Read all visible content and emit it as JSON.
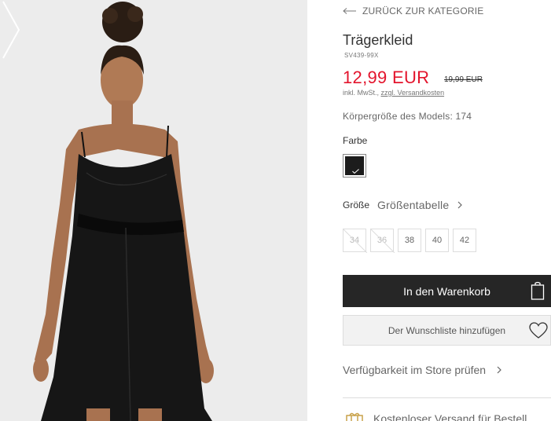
{
  "navigation": {
    "back_label": "ZURÜCK ZUR KATEGORIE"
  },
  "product": {
    "title": "Trägerkleid",
    "sku": "SV439-99X",
    "price": "12,99 EUR",
    "old_price": "19,99 EUR",
    "tax_note": "inkl. MwSt.,",
    "shipping_link": "zzgl. Versandkosten",
    "model_size": "Körpergröße des Models: 174"
  },
  "color": {
    "label": "Farbe",
    "selected_swatch": "#1c1c1c"
  },
  "sizes": {
    "label": "Größe",
    "table_link": "Größentabelle",
    "options": [
      {
        "label": "34",
        "available": false
      },
      {
        "label": "36",
        "available": false
      },
      {
        "label": "38",
        "available": true
      },
      {
        "label": "40",
        "available": true
      },
      {
        "label": "42",
        "available": true
      }
    ]
  },
  "actions": {
    "add_to_cart": "In den Warenkorb",
    "add_to_wishlist": "Der Wunschliste hinzufügen",
    "store_availability": "Verfügbarkeit im Store prüfen"
  },
  "shipping_banner": {
    "text": "Kostenloser Versand für Bestell"
  },
  "colors": {
    "price_red": "#e3142c",
    "button_dark": "#262626",
    "gallery_bg": "#ececec"
  }
}
